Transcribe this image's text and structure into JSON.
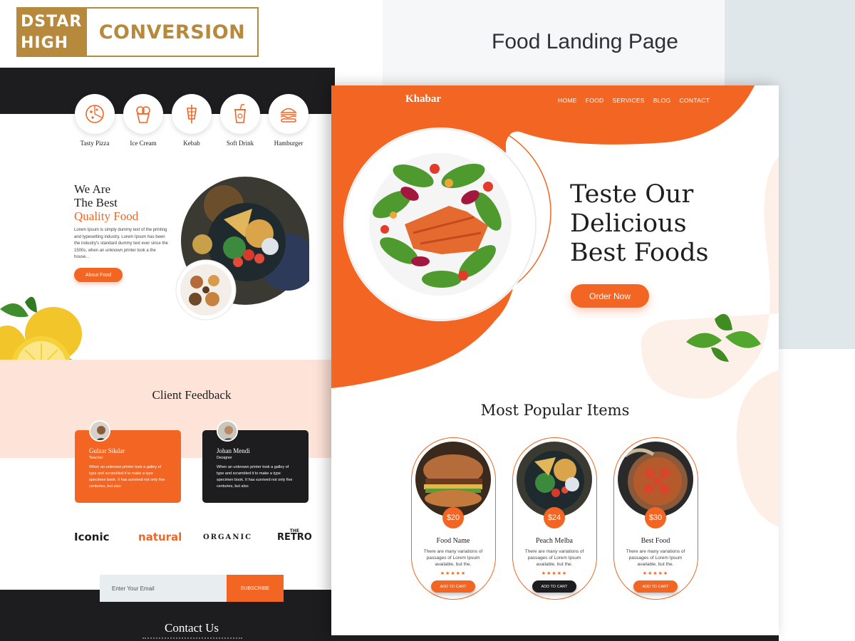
{
  "brand_logo": {
    "line1": "DSTAR",
    "line2": "HIGH",
    "word": "CONVERSION"
  },
  "caption": "Food Landing Page",
  "left_page": {
    "categories": [
      {
        "label": "Tasty Pizza",
        "icon": "pizza-icon"
      },
      {
        "label": "Ice Cream",
        "icon": "ice-cream-icon"
      },
      {
        "label": "Kebab",
        "icon": "kebab-icon"
      },
      {
        "label": "Soft Drink",
        "icon": "soft-drink-icon"
      },
      {
        "label": "Hamburger",
        "icon": "hamburger-icon"
      }
    ],
    "hero": {
      "line1": "We Are",
      "line2": "The Best",
      "line3": "Quality Food",
      "text": "Lorem Ipsum is simply dummy text of the printing and typesetting industry. Lorem Ipsum has been the industry's standard dummy text ever since the 1500s, when an unknown printer took a the house...",
      "button": "About Food"
    },
    "feedback": {
      "title": "Client Feedback",
      "cards": [
        {
          "name": "Gulzar Sikdar",
          "role": "Teacher",
          "text": "When an unknown printer took a galley of type and scrambled it to make a type specimen book. It has survived not only five centuries, but also"
        },
        {
          "name": "Johan Mendi",
          "role": "Designer",
          "text": "When an unknown printer took a galley of type and scrambled it to make a type specimen book. It has survived not only five centuries, but also"
        }
      ]
    },
    "brands": {
      "iconic": "Iconic",
      "natural": "natural",
      "organic": "ORGANIC",
      "retro_top": "THE",
      "retro": "RETRO"
    },
    "newsletter": {
      "placeholder": "Enter Your Email",
      "button": "SUBSCRIBE"
    },
    "contact_title": "Contact Us"
  },
  "right_page": {
    "brand": "Khabar",
    "nav": [
      "HOME",
      "FOOD",
      "SERVICES",
      "BLOG",
      "CONTACT"
    ],
    "hero": {
      "line1": "Teste Our",
      "line2": "Delicious",
      "line3": "Best Foods",
      "button": "Order Now"
    },
    "popular_title": "Most Popular Items",
    "items": [
      {
        "name": "Food Name",
        "price": "$20",
        "desc": "There are many variations of passages of Lorem Ipsum available, but the.",
        "rating": "★★★★★",
        "button": "ADD TO CART"
      },
      {
        "name": "Peach Melba",
        "price": "$24",
        "desc": "There are many variations of passages of Lorem Ipsum available, but the.",
        "rating": "★★★★★",
        "button": "ADD TO CART"
      },
      {
        "name": "Best Food",
        "price": "$30",
        "desc": "There are many variations of passages of Lorem Ipsum available, but the.",
        "rating": "★★★★★",
        "button": "ADD TO CART"
      }
    ]
  },
  "colors": {
    "accent": "#f26522",
    "dark": "#1d1d1f",
    "gold": "#b7893d",
    "peach": "#fde3d8"
  }
}
